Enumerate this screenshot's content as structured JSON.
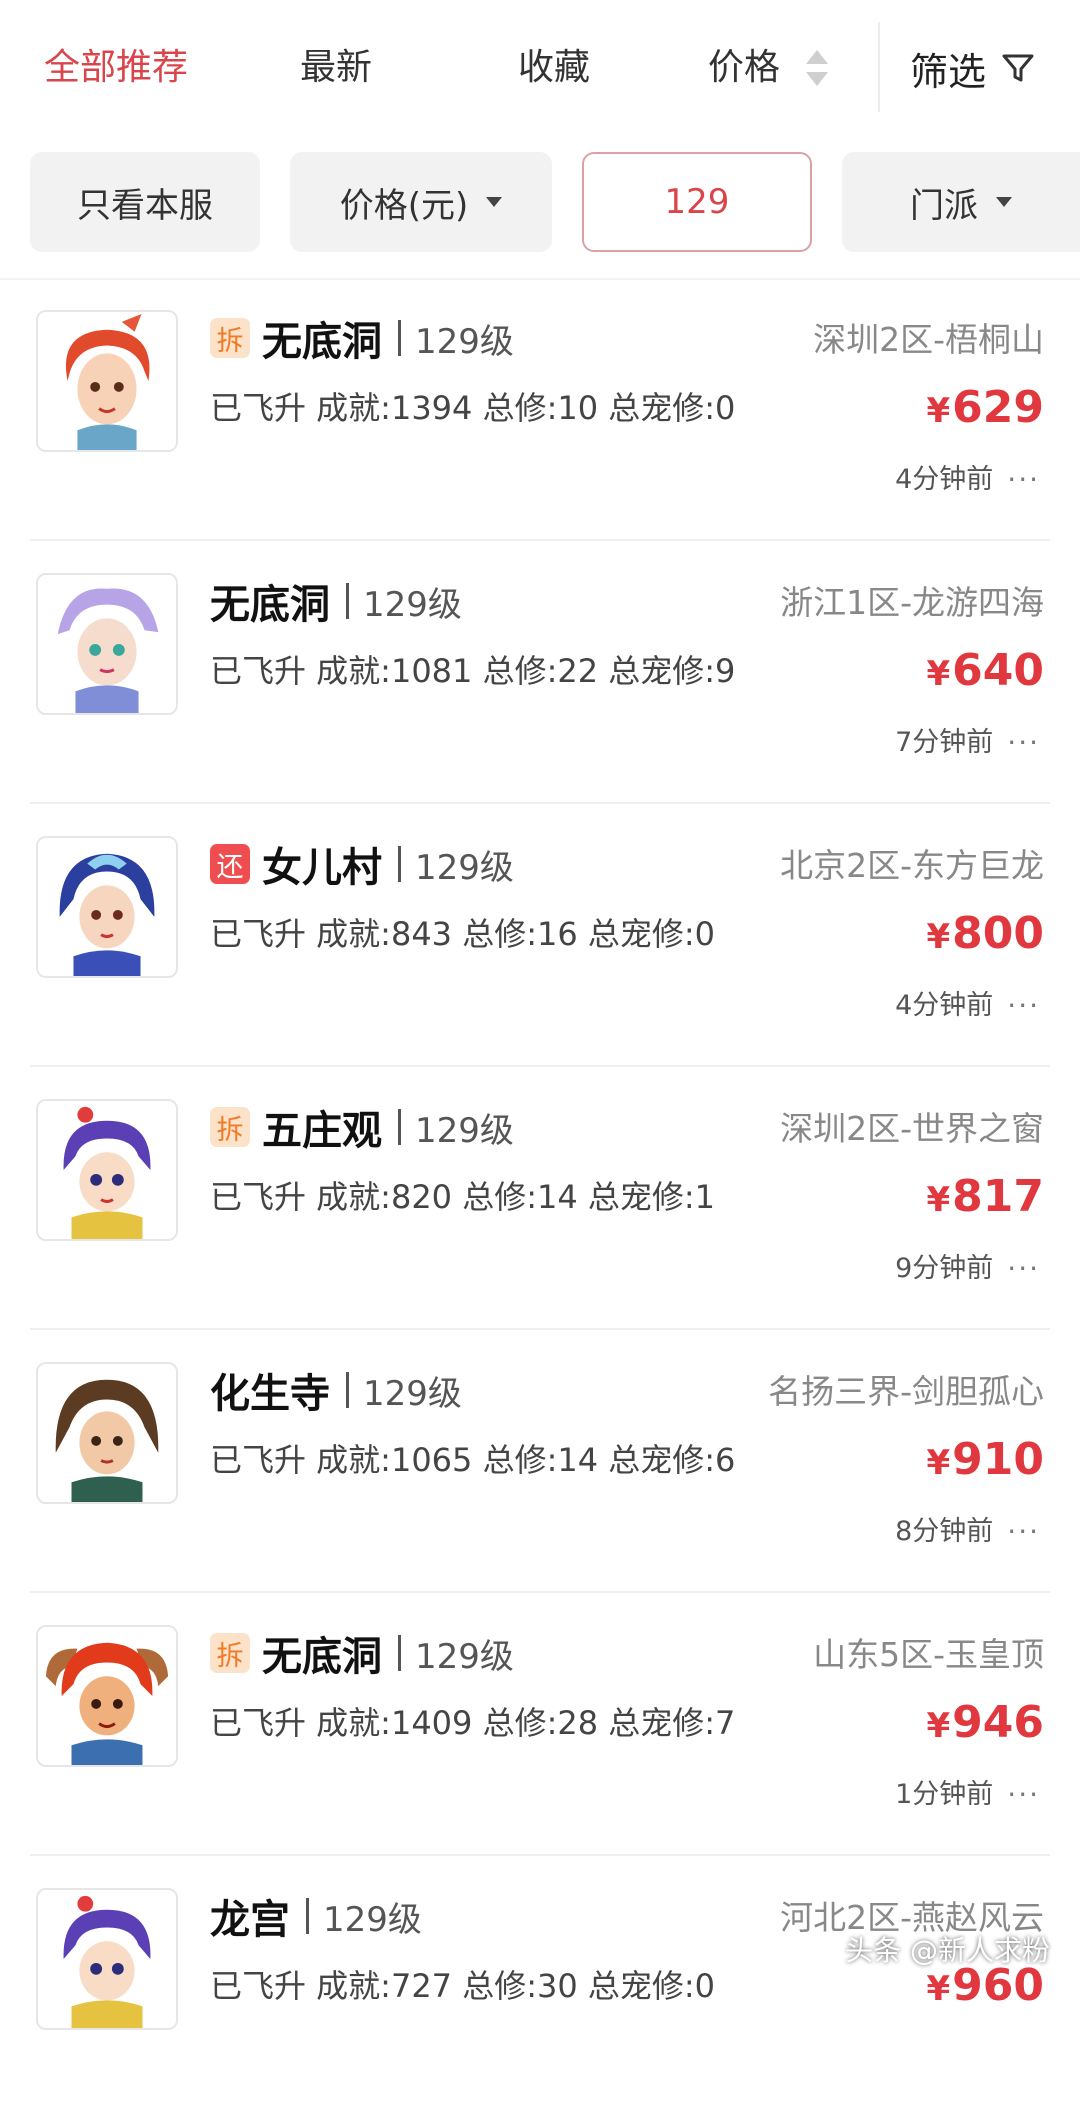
{
  "sort_tabs": {
    "all": "全部推荐",
    "latest": "最新",
    "favorite": "收藏",
    "price": "价格",
    "filter": "筛选"
  },
  "chips": {
    "own_server": "只看本服",
    "price_unit": "价格(元)",
    "level_value": "129",
    "sect": "门派"
  },
  "colors": {
    "accent": "#d9454a",
    "price": "#e0383e",
    "badge_orange_bg": "#fce2c9",
    "badge_red_bg": "#ef4d4f"
  },
  "items": [
    {
      "badge": "拆",
      "badge_type": "orange",
      "school": "无底洞",
      "level": "129级",
      "server": "深圳2区-梧桐山",
      "stats": "已飞升 成就:1394 总修:10 总宠修:0",
      "price": "629",
      "time": "4分钟前",
      "more": "···",
      "avatar_icon": "red-hair-character-icon"
    },
    {
      "badge": "",
      "badge_type": "",
      "school": "无底洞",
      "level": "129级",
      "server": "浙江1区-龙游四海",
      "stats": "已飞升 成就:1081 总修:22 总宠修:9",
      "price": "640",
      "time": "7分钟前",
      "more": "···",
      "avatar_icon": "lavender-hair-character-icon"
    },
    {
      "badge": "还",
      "badge_type": "red",
      "school": "女儿村",
      "level": "129级",
      "server": "北京2区-东方巨龙",
      "stats": "已飞升 成就:843 总修:16 总宠修:0",
      "price": "800",
      "time": "4分钟前",
      "more": "···",
      "avatar_icon": "blue-hair-girl-character-icon"
    },
    {
      "badge": "拆",
      "badge_type": "orange",
      "school": "五庄观",
      "level": "129级",
      "server": "深圳2区-世界之窗",
      "stats": "已飞升 成就:820 总修:14 总宠修:1",
      "price": "817",
      "time": "9分钟前",
      "more": "···",
      "avatar_icon": "purple-hair-boy-character-icon"
    },
    {
      "badge": "",
      "badge_type": "",
      "school": "化生寺",
      "level": "129级",
      "server": "名扬三界-剑胆孤心",
      "stats": "已飞升 成就:1065 总修:14 总宠修:6",
      "price": "910",
      "time": "8分钟前",
      "more": "···",
      "avatar_icon": "brown-hair-swordsman-character-icon"
    },
    {
      "badge": "拆",
      "badge_type": "orange",
      "school": "无底洞",
      "level": "129级",
      "server": "山东5区-玉皇顶",
      "stats": "已飞升 成就:1409 总修:28 总宠修:7",
      "price": "946",
      "time": "1分钟前",
      "more": "···",
      "avatar_icon": "horned-demon-character-icon"
    },
    {
      "badge": "",
      "badge_type": "",
      "school": "龙宫",
      "level": "129级",
      "server": "河北2区-燕赵风云",
      "stats": "已飞升 成就:727 总修:30 总宠修:0",
      "price": "960",
      "time": "",
      "more": "",
      "avatar_icon": "purple-hair-boy-character-icon"
    }
  ],
  "price_prefix": "¥",
  "watermark": "头条 @新人求粉"
}
